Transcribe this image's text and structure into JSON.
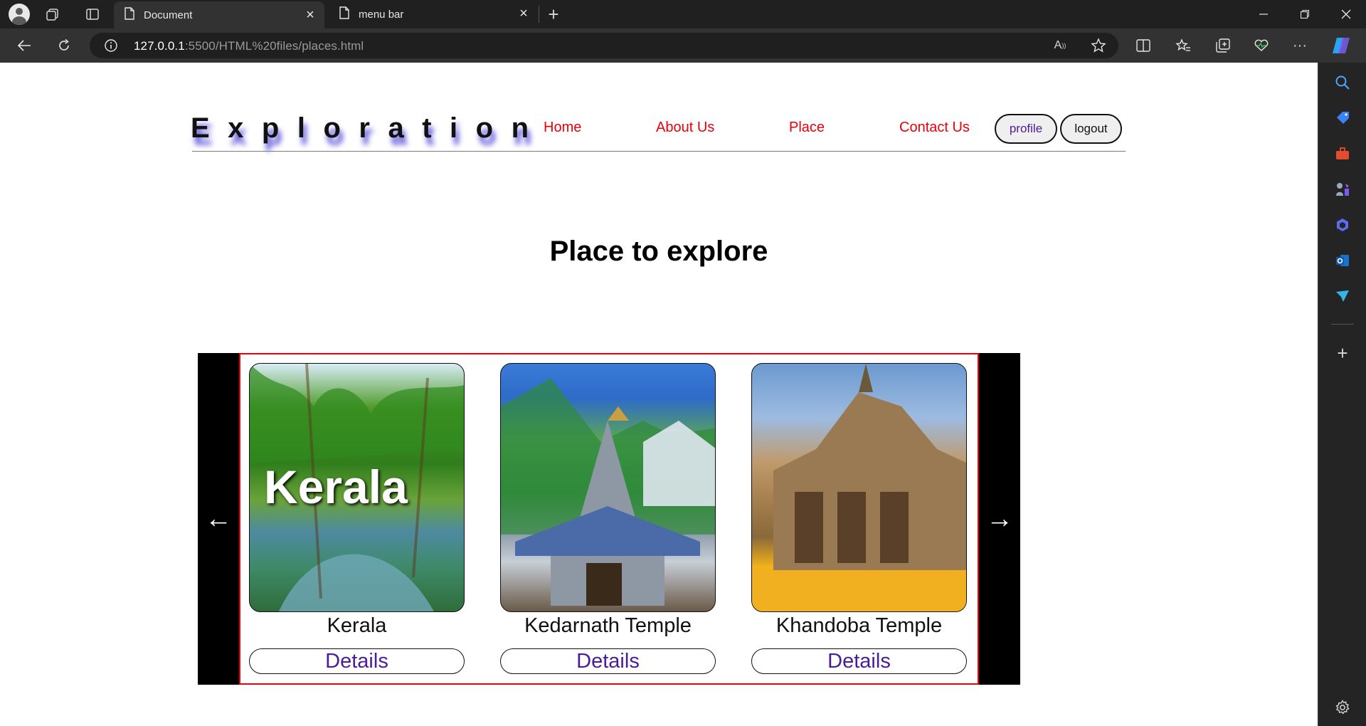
{
  "browser": {
    "tabs": [
      {
        "title": "Document",
        "active": true
      },
      {
        "title": "menu bar",
        "active": false
      }
    ],
    "url_host": "127.0.0.1",
    "url_rest": ":5500/HTML%20files/places.html"
  },
  "header": {
    "brand": "Exploration",
    "nav": {
      "home": "Home",
      "about": "About Us",
      "place": "Place",
      "contact": "Contact Us"
    },
    "profile_label": "profile",
    "logout_label": "logout"
  },
  "main": {
    "title": "Place to explore",
    "slider": {
      "prev_arrow": "←",
      "next_arrow": "→",
      "cards": [
        {
          "name": "Kerala",
          "image_text": "Kerala",
          "button": "Details"
        },
        {
          "name": "Kedarnath Temple",
          "button": "Details"
        },
        {
          "name": "Khandoba Temple",
          "button": "Details"
        }
      ]
    }
  },
  "colors": {
    "nav_link": "#e8000b",
    "button_text": "#4b1c9a",
    "brand_shadow": "#4b42d6",
    "slider_border": "#e8000b"
  }
}
